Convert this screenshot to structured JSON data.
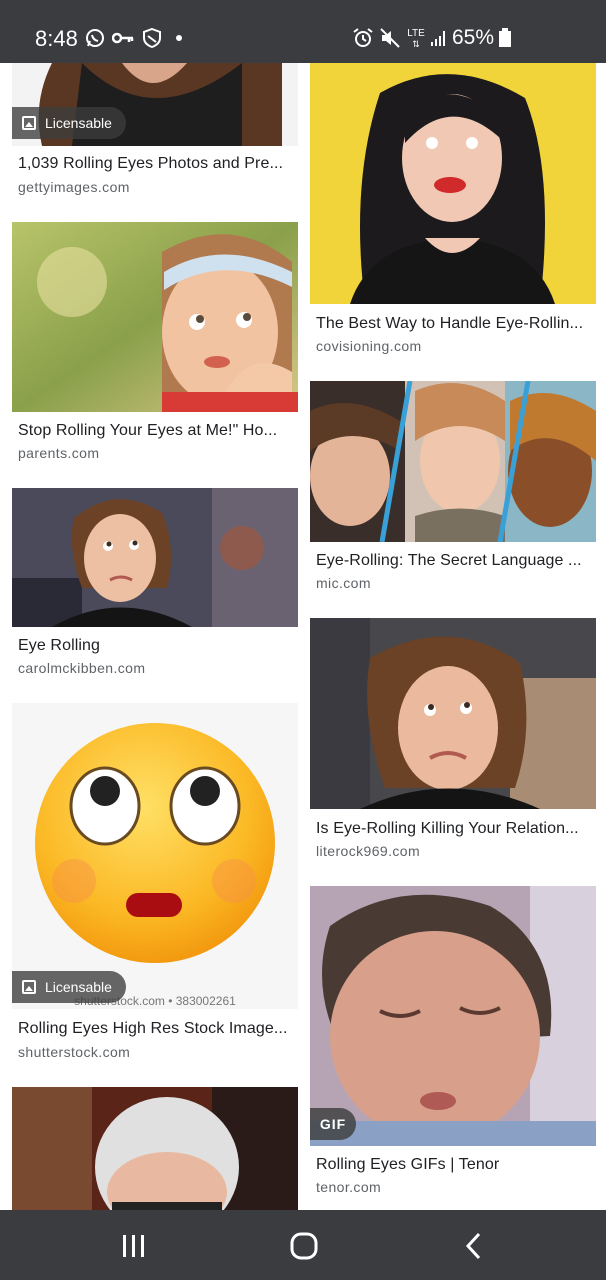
{
  "status_bar": {
    "time": "8:48",
    "network": "LTE",
    "battery": "65%",
    "icons": [
      "whatsapp-icon",
      "vpn-key-icon",
      "shield-icon",
      "dot-icon",
      "alarm-icon",
      "mute-icon",
      "lte-icon",
      "signal-icon",
      "battery-icon"
    ]
  },
  "results": {
    "left": [
      {
        "title": "1,039 Rolling Eyes Photos and Pre...",
        "source": "gettyimages.com",
        "badge": "Licensable"
      },
      {
        "title": "Stop Rolling Your Eyes at Me!\" Ho...",
        "source": "parents.com"
      },
      {
        "title": "Eye Rolling",
        "source": "carolmckibben.com"
      },
      {
        "title": "Rolling Eyes High Res Stock Image...",
        "source": "shutterstock.com",
        "badge": "Licensable",
        "watermark": "shutterstock.com • 383002261"
      },
      {
        "title": "",
        "source": ""
      }
    ],
    "right": [
      {
        "title": "The Best Way to Handle Eye-Rollin...",
        "source": "covisioning.com"
      },
      {
        "title": "Eye-Rolling: The Secret Language ...",
        "source": "mic.com"
      },
      {
        "title": "Is Eye-Rolling Killing Your Relation...",
        "source": "literock969.com"
      },
      {
        "title": "Rolling Eyes GIFs | Tenor",
        "source": "tenor.com",
        "badge": "GIF"
      }
    ]
  },
  "nav_bar": {
    "icons": [
      "recent-apps-icon",
      "home-icon",
      "back-icon"
    ]
  },
  "colors": {
    "status_bar": "#3a3c3f",
    "title": "#202124",
    "source": "#5f6368",
    "yellow": "#f1d43a"
  }
}
